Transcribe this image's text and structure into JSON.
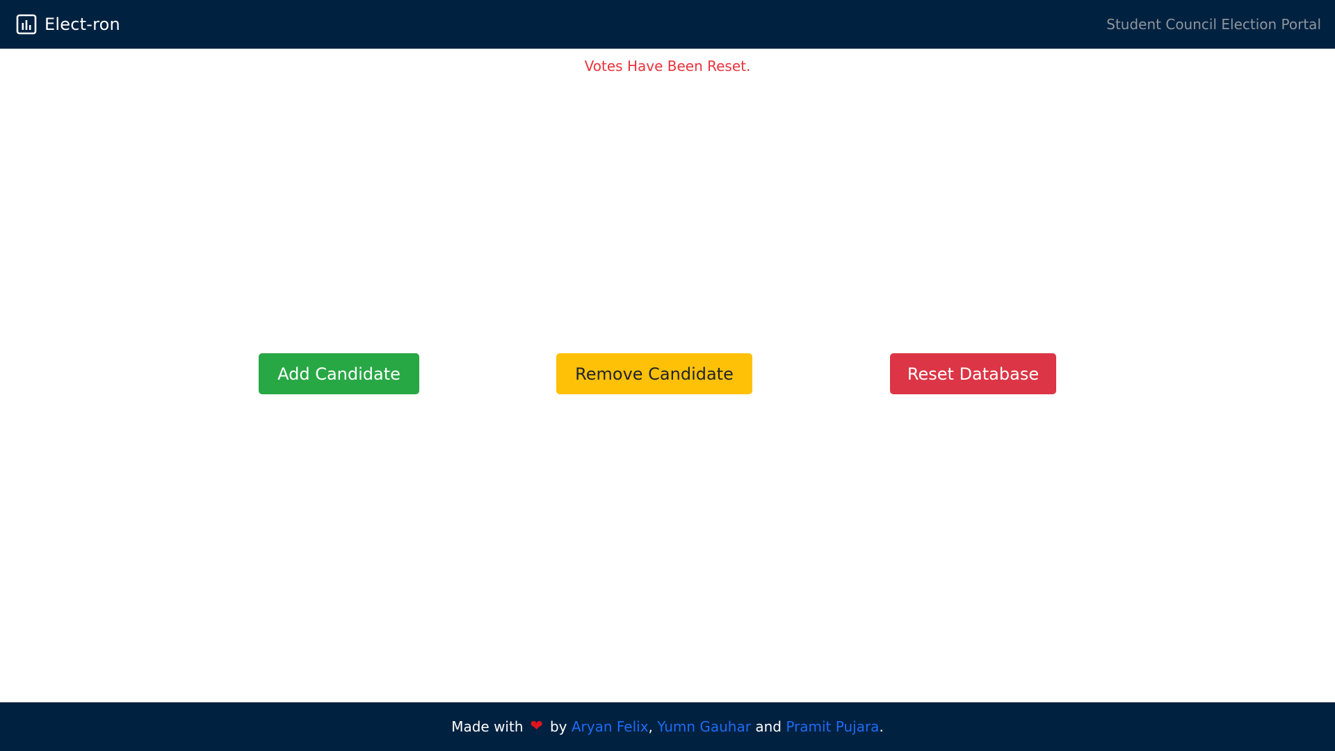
{
  "navbar": {
    "brand_icon": "bar-chart-icon",
    "brand_text": "Elect-ron",
    "subtitle": "Student Council Election Portal",
    "background": "#002140"
  },
  "alert": {
    "message": "Votes Have Been Reset.",
    "color": "#e8323c"
  },
  "actions": {
    "add_label": "Add Candidate",
    "remove_label": "Remove Candidate",
    "reset_label": "Reset Database",
    "add_color": "#28a745",
    "remove_color": "#ffc107",
    "reset_color": "#dc3545"
  },
  "footer": {
    "made_with": "Made with",
    "heart_icon": "heart-icon",
    "by": "by",
    "author1": "Aryan Felix",
    "comma": ",",
    "author2": "Yumn Gauhar",
    "and": "and",
    "author3": "Pramit Pujara",
    "period": "."
  }
}
